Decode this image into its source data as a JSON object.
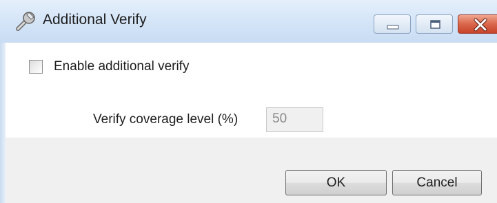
{
  "window": {
    "title": "Additional Verify",
    "icon": "wrench-icon",
    "controls": [
      "minimize-icon",
      "maximize-icon",
      "close-icon"
    ],
    "colors": {
      "titlebar": "#d6e6f8",
      "close_button": "#d9664a",
      "footer": "#f0f0f0"
    }
  },
  "options": {
    "enable_label": "Enable additional verify",
    "enable_checked": false,
    "coverage_label": "Verify coverage level (%)",
    "coverage_value": "50",
    "coverage_enabled": false
  },
  "buttons": {
    "ok_label": "OK",
    "cancel_label": "Cancel"
  }
}
